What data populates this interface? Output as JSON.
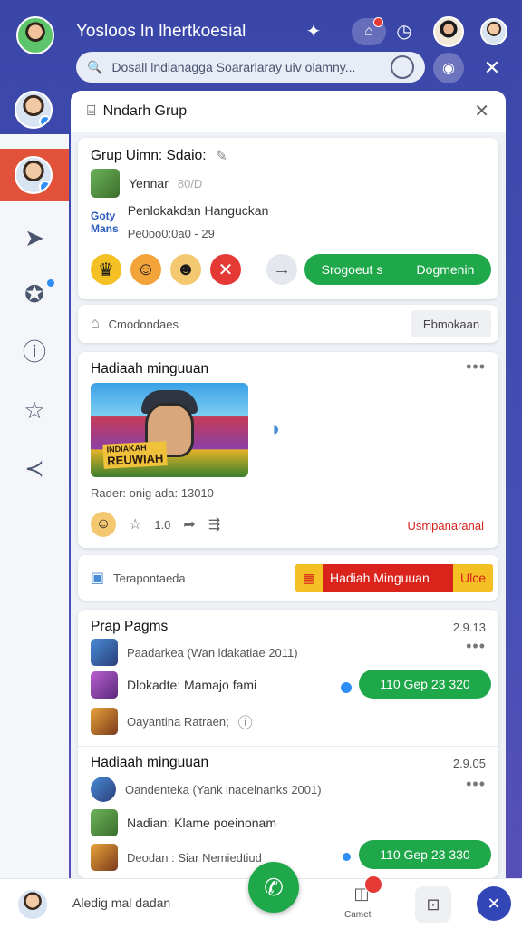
{
  "app": {
    "title": "Yosloos ln lhertkoesial"
  },
  "search": {
    "text": "Dosall lndianagga Soararlaray uiv olamny..."
  },
  "panel": {
    "title": "Nndarh Grup"
  },
  "group_card": {
    "title": "Grup Uimn: Sdaio:",
    "line1_name": "Yennar",
    "line1_meta": "80/D",
    "logo_top": "Goty",
    "logo_bottom": "Mans",
    "line2": "Penlokakdan Hanguckan",
    "line3": "Pe0oo0:0a0 - 29",
    "green_left": "Srogoeut s",
    "green_right": "Dogmenin"
  },
  "condition_row": {
    "label": "Cmodondaes",
    "button": "Ebmokaan"
  },
  "post_card": {
    "title": "Hadiaah minguuan",
    "image_text": "REUWIAH",
    "image_subtext": "INDIAKAH",
    "caption": "Rader: onig ada: 13010",
    "rating": "1.0",
    "link": "Usmpanaranal"
  },
  "promo_row": {
    "label": "Terapontaeda",
    "badge": "Hadiah Minguuan",
    "badge_tag": "Ulce"
  },
  "list1": {
    "title": "Prap Pagms",
    "date": "2.9.13",
    "items": [
      {
        "text": "Paadarkea (Wan ldakatiae 2011)"
      },
      {
        "text": "Dlokadte: Mamajo fami",
        "pill": "110 Gep 23  320"
      },
      {
        "text": "Oayantina Ratraen;"
      }
    ]
  },
  "list2": {
    "title": "Hadiaah minguuan",
    "date": "2.9.05",
    "items": [
      {
        "text": "Oandenteka (Yank lnacelnanks 2001)"
      },
      {
        "text": "Nadian: Klame poeinonam"
      },
      {
        "text": "Deodan : Siar Nemiedtiud",
        "pill": "110 Gep 23  330"
      }
    ]
  },
  "bottom": {
    "input_label": "Aledig mal dadan",
    "camera_label": "Camet"
  },
  "colors": {
    "accent": "#3a46a8",
    "green": "#1fa84a",
    "red": "#d9231b"
  }
}
